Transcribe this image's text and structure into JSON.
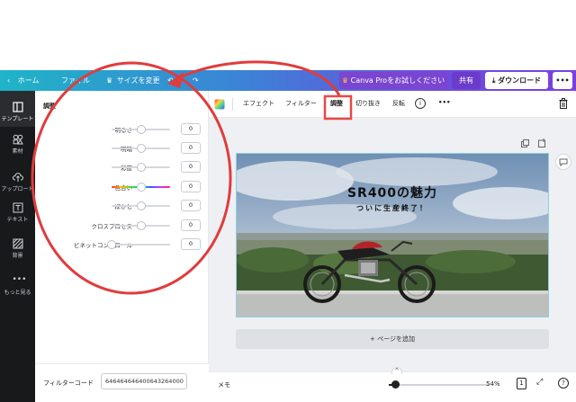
{
  "topbar": {
    "home_label": "ホーム",
    "file_label": "ファイル",
    "resize_label": "サイズを変更",
    "pro_trial_label": "Canva Proをお試しください",
    "share_label": "共有",
    "download_label": "ダウンロード",
    "more_label": "•••"
  },
  "rail": {
    "items": [
      {
        "label": "テンプレート",
        "icon": "layout-icon"
      },
      {
        "label": "素材",
        "icon": "elements-icon"
      },
      {
        "label": "アップロード",
        "icon": "upload-icon"
      },
      {
        "label": "テキスト",
        "icon": "text-icon"
      },
      {
        "label": "背景",
        "icon": "background-icon"
      },
      {
        "label": "もっと見る",
        "icon": "more-icon"
      }
    ]
  },
  "panel": {
    "title": "調整",
    "sliders": [
      {
        "label": "明るさ",
        "value": "0",
        "level": 0.5
      },
      {
        "label": "明暗",
        "value": "0",
        "level": 0.5
      },
      {
        "label": "彩度",
        "value": "0",
        "level": 0.5
      },
      {
        "label": "色合い",
        "value": "0",
        "level": 0.5
      },
      {
        "label": "ぼかし",
        "value": "0",
        "level": 0.5
      },
      {
        "label": "クロスプロセス",
        "value": "0",
        "level": 0.5
      },
      {
        "label": "ビネットコントロール",
        "value": "0",
        "level": 0.0
      }
    ],
    "filter_code_label": "フィルターコード",
    "filter_code_value": "646464646400643264000"
  },
  "toolbar": {
    "effects_label": "エフェクト",
    "filter_label": "フィルター",
    "adjust_label": "調整",
    "crop_label": "切り抜き",
    "flip_label": "反転",
    "more_label": "•••"
  },
  "canvas": {
    "headline": "SR400の魅力",
    "subline": "ついに生産終了！"
  },
  "workspace": {
    "add_page_label": "+ ページを追加"
  },
  "bottombar": {
    "notes_label": "メモ",
    "zoom_value": "54%",
    "page_count": "1"
  },
  "colors": {
    "annotation_red": "#e03c3c",
    "highlight_box": "#e84848",
    "rail_bg": "#18191b",
    "topbar_start": "#1fb4c7",
    "topbar_end": "#7b3fe0"
  }
}
